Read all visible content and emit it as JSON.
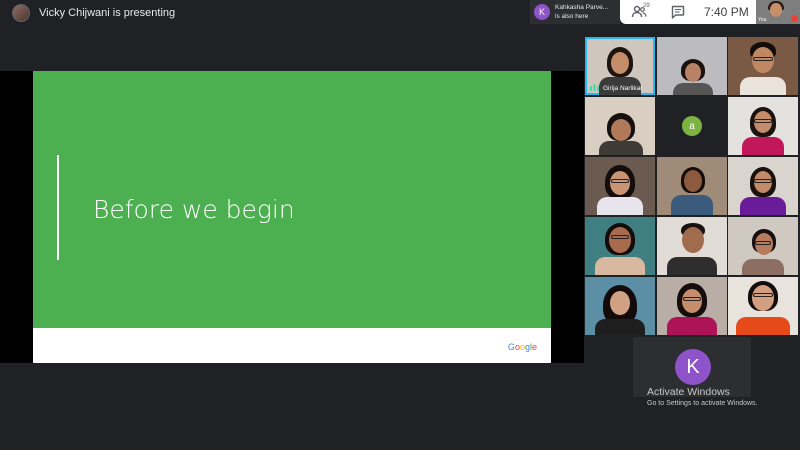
{
  "presenter": {
    "text": "Vicky Chijwani is presenting"
  },
  "toast": {
    "avatar_letter": "K",
    "line1": "Kahkasha Parve...",
    "line2": "is also here"
  },
  "topbar": {
    "people_count": "29",
    "time": "7:40 PM",
    "self_label": "You"
  },
  "slide": {
    "title": "Before we begin",
    "footer_logo": [
      "G",
      "o",
      "o",
      "g",
      "l",
      "e"
    ]
  },
  "participants": {
    "speaking_name": "Girija Narlikar",
    "a_letter": "a",
    "k_letter": "K"
  },
  "watermark": {
    "title": "Activate Windows",
    "subtitle": "Go to Settings to activate Windows."
  },
  "colors": {
    "slide_green": "#4caf50",
    "background": "#202124",
    "avatar_purple": "#8e53c9",
    "avatar_green": "#7cb342",
    "audio_bars": "#3dd7a8"
  }
}
